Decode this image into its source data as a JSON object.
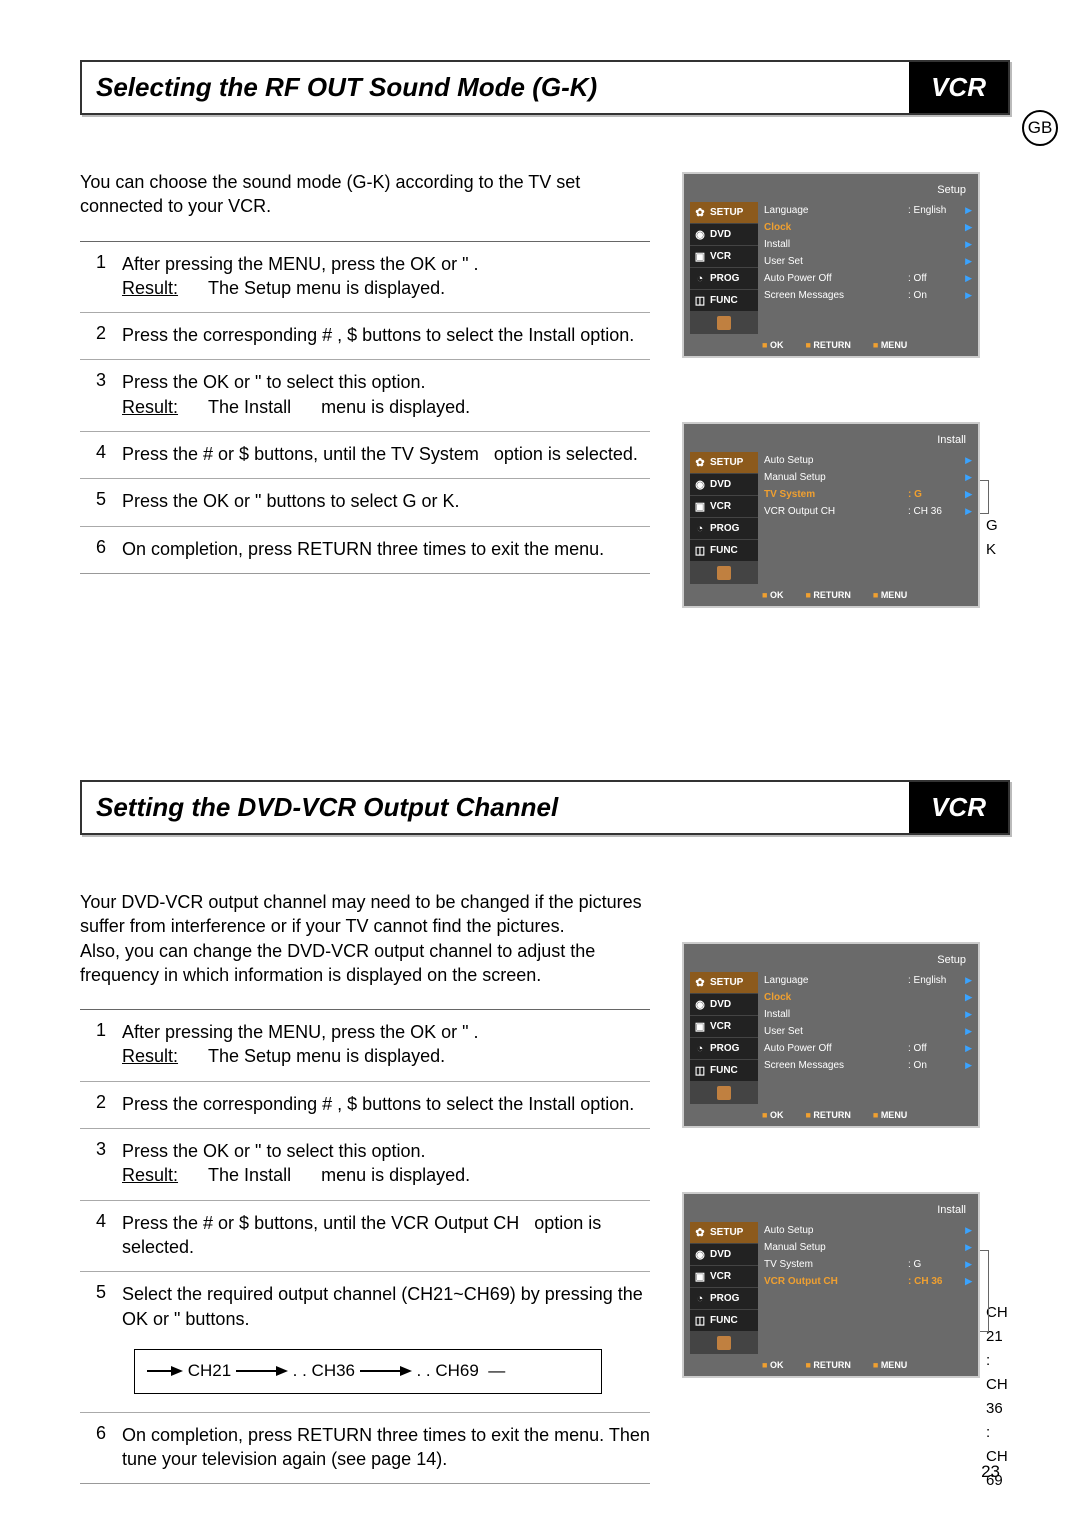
{
  "lang_badge": "GB",
  "page_number": "23",
  "section1": {
    "title": "Selecting the RF OUT Sound Mode (G-K)",
    "badge": "VCR",
    "intro": "You can choose the sound mode (G-K) according to the TV set connected to your VCR.",
    "steps": [
      {
        "n": "1",
        "html": "After pressing the MENU, press the OK or \"  .<br><span class='u'>Result:</span>&nbsp;&nbsp;&nbsp;&nbsp;&nbsp;&nbsp;The Setup menu is displayed."
      },
      {
        "n": "2",
        "html": "Press the corresponding  #  , $   buttons to select the  Install option."
      },
      {
        "n": "3",
        "html": "Press the OK or \"   to select this option.<br><span class='u'>Result:</span>&nbsp;&nbsp;&nbsp;&nbsp;&nbsp;&nbsp;The Install &nbsp;&nbsp;&nbsp;&nbsp;&nbsp;menu is displayed."
      },
      {
        "n": "4",
        "html": "Press the  # or  $   buttons, until the TV System&nbsp;&nbsp;&nbsp;option is selected."
      },
      {
        "n": "5",
        "html": "Press the OK or \"   buttons to select G or K."
      },
      {
        "n": "6",
        "html": "On completion, press RETURN three times to exit the menu."
      }
    ],
    "osd1": {
      "screen_title": "Setup",
      "tabs": [
        "SETUP",
        "DVD",
        "VCR",
        "PROG",
        "FUNC"
      ],
      "tab_selected": "SETUP",
      "rows": [
        {
          "lbl": "Language",
          "val": ": English"
        },
        {
          "lbl": "Clock",
          "val": "",
          "hl": true
        },
        {
          "lbl": "Install",
          "val": ""
        },
        {
          "lbl": "User Set",
          "val": ""
        },
        {
          "lbl": "Auto Power Off",
          "val": ": Off"
        },
        {
          "lbl": "Screen Messages",
          "val": ": On"
        }
      ],
      "foot": [
        "OK",
        "RETURN",
        "MENU"
      ]
    },
    "osd2": {
      "screen_title": "Install",
      "tabs": [
        "SETUP",
        "DVD",
        "VCR",
        "PROG",
        "FUNC"
      ],
      "tab_selected": "SETUP",
      "rows": [
        {
          "lbl": "Auto Setup",
          "val": ""
        },
        {
          "lbl": "Manual Setup",
          "val": ""
        },
        {
          "lbl": "TV System",
          "val": ": G",
          "hl": true
        },
        {
          "lbl": "VCR Output CH",
          "val": ": CH 36"
        }
      ],
      "foot": [
        "OK",
        "RETURN",
        "MENU"
      ],
      "callout": [
        "G",
        "K"
      ]
    }
  },
  "section2": {
    "title": "Setting the DVD-VCR Output Channel",
    "badge": "VCR",
    "intro": "Your DVD-VCR output channel may need to be changed if the pictures suffer from interference or if your TV cannot find the pictures.<br>Also, you can change the DVD-VCR output channel to adjust the frequency in which information is displayed on the screen.",
    "steps": [
      {
        "n": "1",
        "html": "After pressing the MENU, press the OK or \"  .<br><span class='u'>Result:</span>&nbsp;&nbsp;&nbsp;&nbsp;&nbsp;&nbsp;The Setup menu is displayed."
      },
      {
        "n": "2",
        "html": "Press the corresponding  #  , $   buttons to select the Install option."
      },
      {
        "n": "3",
        "html": "Press the OK or \"   to select this option.<br><span class='u'>Result:</span>&nbsp;&nbsp;&nbsp;&nbsp;&nbsp;&nbsp;The Install &nbsp;&nbsp;&nbsp;&nbsp;&nbsp;menu is displayed."
      },
      {
        "n": "4",
        "html": "Press the  # or  $   buttons, until the VCR Output CH&nbsp;&nbsp;&nbsp;option is selected."
      },
      {
        "n": "5",
        "html": "Select the required output channel (CH21~CH69) by pressing the  OK or \"  buttons.",
        "flow": [
          "CH21",
          ". . CH36",
          ". . CH69"
        ]
      },
      {
        "n": "6",
        "html": "On completion, press RETURN three times to exit the menu. Then tune your television again (see page 14)."
      }
    ],
    "osd1": {
      "screen_title": "Setup",
      "tabs": [
        "SETUP",
        "DVD",
        "VCR",
        "PROG",
        "FUNC"
      ],
      "tab_selected": "SETUP",
      "rows": [
        {
          "lbl": "Language",
          "val": ": English"
        },
        {
          "lbl": "Clock",
          "val": "",
          "hl": true
        },
        {
          "lbl": "Install",
          "val": ""
        },
        {
          "lbl": "User Set",
          "val": ""
        },
        {
          "lbl": "Auto Power Off",
          "val": ": Off"
        },
        {
          "lbl": "Screen Messages",
          "val": ": On"
        }
      ],
      "foot": [
        "OK",
        "RETURN",
        "MENU"
      ]
    },
    "osd2": {
      "screen_title": "Install",
      "tabs": [
        "SETUP",
        "DVD",
        "VCR",
        "PROG",
        "FUNC"
      ],
      "tab_selected": "SETUP",
      "rows": [
        {
          "lbl": "Auto Setup",
          "val": ""
        },
        {
          "lbl": "Manual Setup",
          "val": ""
        },
        {
          "lbl": "TV System",
          "val": ": G"
        },
        {
          "lbl": "VCR Output CH",
          "val": ": CH 36",
          "hl": true
        }
      ],
      "foot": [
        "OK",
        "RETURN",
        "MENU"
      ],
      "callout": [
        "CH 21",
        ":",
        "CH 36",
        ":",
        "CH 69"
      ]
    }
  }
}
